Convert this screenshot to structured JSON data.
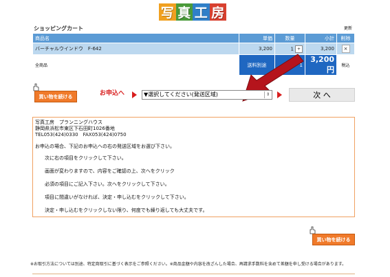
{
  "logo": {
    "chars": [
      "写",
      "真",
      "工",
      "房"
    ]
  },
  "cart": {
    "title": "ショッピングカート",
    "update_link": "更新",
    "headers": {
      "product": "商品名",
      "unit_price": "単価",
      "quantity": "数量",
      "subtotal": "小計",
      "delete": "削除"
    },
    "items": [
      {
        "name": "バーチャルウインドウ　F-642",
        "unit_price": "3,200",
        "quantity": "1",
        "qty_button": "+",
        "subtotal": "3,200",
        "delete_button": "×"
      }
    ],
    "footer": {
      "total_label": "全商品",
      "shipping_label": "送料別途",
      "quantity_total": "1",
      "grand_total": "3,200円",
      "tax_label": "税込"
    }
  },
  "actions": {
    "continue_shopping": "買い物を続ける",
    "apply_label": "お申込へ",
    "region_select": "▼選択してください(発送区域)",
    "next_button": "次 へ"
  },
  "info": {
    "company": "写真工房　プランニングハウス",
    "address": "静岡県浜松市東区下石田町1026番地",
    "contact": "TEL053(424)0330　FAX053(424)0750",
    "intro": "お申込の場合、下記のお申込への右の発送区域をお選び下さい。",
    "steps": [
      "次に右の項目をクリックして下さい。",
      "画面が変わりますので、内容をご確認の上、次へをクリック",
      "必須の項目にご記入下さい。次へをクリックして下さい。",
      "項目に間違いがなければ、決定・申し込むをクリックして下さい。",
      "決定・申し込むをクリックしない限り、何度でも繰り返しても大丈夫です。"
    ]
  },
  "bottom": {
    "continue_shopping": "買い物を続ける",
    "footnote": "※お取引方法については別途、特定商取引に基づく表示をご参照ください。※商品金額や内容を改ざんした場合、再請求手数料を含めて差額を申し受ける場合があります。"
  },
  "colors": {
    "header_blue": "#5b9bd5",
    "row_blue": "#bcd8ef",
    "total_blue": "#1f67c1",
    "accent_red": "#d81e1e",
    "button_orange": "#f07a2a"
  }
}
